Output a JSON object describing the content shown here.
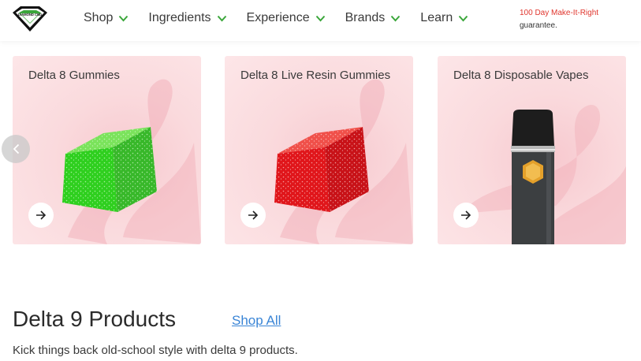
{
  "header": {
    "logo_text": "DIAMOND CBD",
    "nav": [
      {
        "label": "Shop"
      },
      {
        "label": "Ingredients"
      },
      {
        "label": "Experience"
      },
      {
        "label": "Brands"
      },
      {
        "label": "Learn"
      }
    ],
    "guarantee_line1": "100 Day Make-It-Right",
    "guarantee_line2": "guarantee."
  },
  "cards": [
    {
      "title": "Delta 8 Gummies",
      "product": "green-gummy-cube"
    },
    {
      "title": "Delta 8 Live Resin Gummies",
      "product": "red-gummy-cube"
    },
    {
      "title": "Delta 8 Disposable Vapes",
      "product": "disposable-vape-pen"
    }
  ],
  "section": {
    "title": "Delta 9 Products",
    "shop_all": "Shop All",
    "description": "Kick things back old-school style with delta 9 products."
  },
  "colors": {
    "accent_green": "#3aa63a",
    "guarantee_red": "#e0362e",
    "link_blue": "#3a85d6",
    "card_pink": "#fadadd"
  }
}
